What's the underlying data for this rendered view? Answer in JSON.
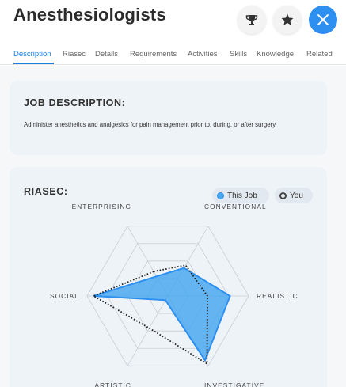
{
  "header": {
    "title": "Anesthesiologists",
    "icons": {
      "trophy": "trophy-icon",
      "star": "star-icon",
      "close": "close-icon"
    },
    "close_color": "#2d8ff0"
  },
  "tabs": [
    {
      "label": "Description",
      "active": true
    },
    {
      "label": "Riasec",
      "active": false
    },
    {
      "label": "Details",
      "active": false
    },
    {
      "label": "Requirements",
      "active": false
    },
    {
      "label": "Activities",
      "active": false
    },
    {
      "label": "Skills",
      "active": false
    },
    {
      "label": "Knowledge",
      "active": false
    },
    {
      "label": "Related",
      "active": false
    }
  ],
  "job_description": {
    "heading": "JOB DESCRIPTION:",
    "text": "Administer anesthetics and analgesics for pain management prior to, during, or after surgery."
  },
  "riasec": {
    "heading": "RIASEC:",
    "legend": {
      "this_job": "This Job",
      "you": "You"
    },
    "colors": {
      "this_job_fill": "#4aa8f0",
      "this_job_stroke": "#2d8ff0",
      "you_stroke": "#222222"
    }
  },
  "chart_data": {
    "type": "radar",
    "axes": [
      "ENTERPRISING",
      "CONVENTIONAL",
      "REALISTIC",
      "INVESTIGATIVE",
      "ARTISTIC",
      "SOCIAL"
    ],
    "scale": [
      0,
      1
    ],
    "rings": 4,
    "series": [
      {
        "name": "This Job",
        "values": [
          0.28,
          0.4,
          0.77,
          0.92,
          0.06,
          0.92
        ]
      },
      {
        "name": "You",
        "values": [
          0.35,
          0.44,
          0.49,
          0.97,
          0.46,
          0.92
        ]
      }
    ]
  }
}
